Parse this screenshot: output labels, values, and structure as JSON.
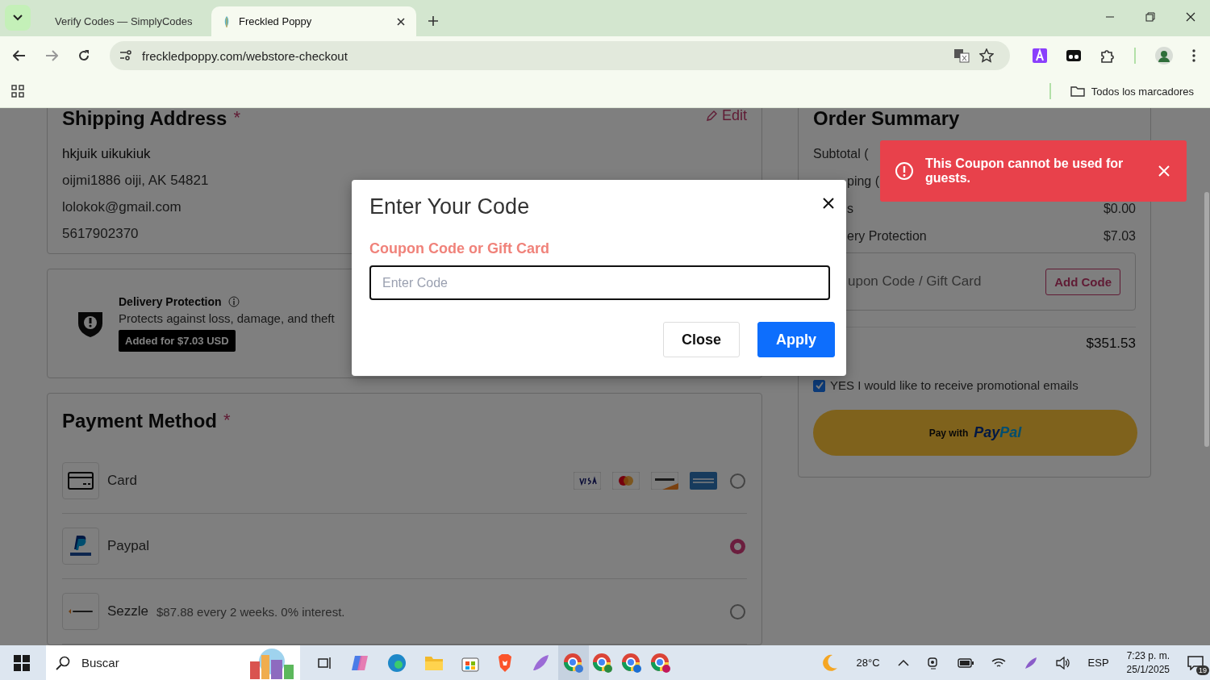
{
  "browser": {
    "tabs": [
      {
        "title": "Verify Codes — SimplyCodes",
        "selected": false
      },
      {
        "title": "Freckled Poppy",
        "selected": true
      }
    ],
    "url": "freckledpoppy.com/webstore-checkout",
    "bookmarks_folder": "Todos los marcadores"
  },
  "shipping": {
    "title": "Shipping Address",
    "required": "*",
    "edit": "Edit",
    "lines": [
      "hkjuik uikukiuk",
      "oijmi1886 oiji, AK 54821",
      "lolokok@gmail.com",
      "5617902370"
    ]
  },
  "delivery_protection": {
    "title": "Delivery Protection",
    "description": "Protects against loss, damage, and theft",
    "badge": "Added for $7.03 USD"
  },
  "payment": {
    "title": "Payment Method",
    "required": "*",
    "methods": [
      {
        "kind": "card",
        "label": "Card",
        "selected": false
      },
      {
        "kind": "paypal",
        "label": "Paypal",
        "selected": true
      },
      {
        "kind": "sezzle",
        "label": "Sezzle",
        "detail": "$87.88 every 2 weeks. 0% interest.",
        "selected": false
      }
    ]
  },
  "order_summary": {
    "title": "Order Summary",
    "rows": [
      {
        "label": "Subtotal (",
        "value": ""
      },
      {
        "label": "ping (",
        "value": ""
      },
      {
        "label": "s",
        "value": "$0.00"
      },
      {
        "label": "ery Protection",
        "value": "$7.03"
      }
    ],
    "coupon_placeholder": "upon Code / Gift Card",
    "add_code": "Add Code",
    "total": "$351.53",
    "promo": {
      "label": "YES I would like to receive promotional emails",
      "checked": true
    },
    "paypal_button": {
      "prefix": "Pay with",
      "brand_1": "Pay",
      "brand_2": "Pal"
    }
  },
  "modal": {
    "title": "Enter Your Code",
    "field_label": "Coupon Code or Gift Card",
    "placeholder": "Enter Code",
    "buttons": [
      {
        "kind": "secondary",
        "label": "Close"
      },
      {
        "kind": "primary",
        "label": "Apply"
      }
    ]
  },
  "toast": {
    "message": "This Coupon cannot be used for guests."
  },
  "taskbar": {
    "search": "Buscar",
    "weather": "28°C",
    "language": "ESP",
    "time": "7:23 p. m.",
    "date": "25/1/2025",
    "notifications": "19"
  }
}
